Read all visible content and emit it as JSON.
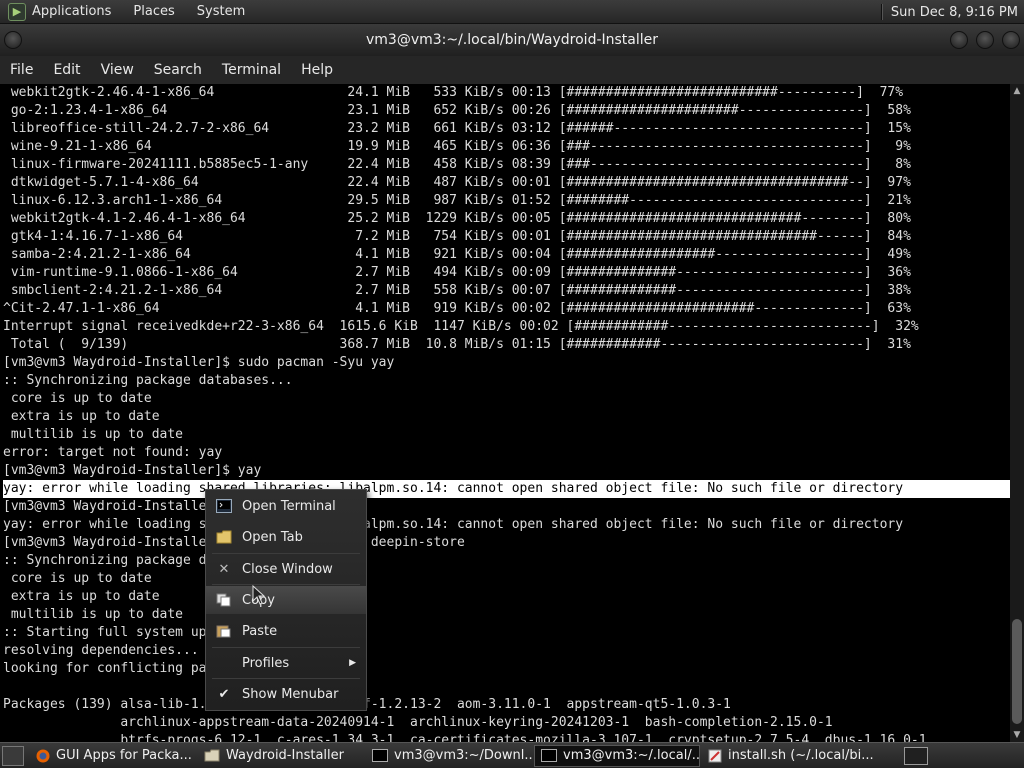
{
  "top_panel": {
    "menus": [
      "Applications",
      "Places",
      "System"
    ],
    "clock": "Sun Dec  8,  9:16 PM"
  },
  "window": {
    "title": "vm3@vm3:~/.local/bin/Waydroid-Installer"
  },
  "menubar": [
    "File",
    "Edit",
    "View",
    "Search",
    "Terminal",
    "Help"
  ],
  "terminal": {
    "lines": [
      " webkit2gtk-2.46.4-1-x86_64                 24.1 MiB   533 KiB/s 00:13 [###########################----------]  77%",
      " go-2:1.23.4-1-x86_64                       23.1 MiB   652 KiB/s 00:26 [######################----------------]  58%",
      " libreoffice-still-24.2.7-2-x86_64          23.2 MiB   661 KiB/s 03:12 [######--------------------------------]  15%",
      " wine-9.21-1-x86_64                         19.9 MiB   465 KiB/s 06:36 [###-----------------------------------]   9%",
      " linux-firmware-20241111.b5885ec5-1-any     22.4 MiB   458 KiB/s 08:39 [###-----------------------------------]   8%",
      " dtkwidget-5.7.1-4-x86_64                   22.4 MiB   487 KiB/s 00:01 [####################################--]  97%",
      " linux-6.12.3.arch1-1-x86_64                29.5 MiB   987 KiB/s 01:52 [########------------------------------]  21%",
      " webkit2gtk-4.1-2.46.4-1-x86_64             25.2 MiB  1229 KiB/s 00:05 [##############################--------]  80%",
      " gtk4-1:4.16.7-1-x86_64                      7.2 MiB   754 KiB/s 00:01 [################################------]  84%",
      " samba-2:4.21.2-1-x86_64                     4.1 MiB   921 KiB/s 00:04 [###################-------------------]  49%",
      " vim-runtime-9.1.0866-1-x86_64               2.7 MiB   494 KiB/s 00:09 [##############------------------------]  36%",
      " smbclient-2:4.21.2-1-x86_64                 2.7 MiB   558 KiB/s 00:07 [##############------------------------]  38%",
      "^Cit-2.47.1-1-x86_64                         4.1 MiB   919 KiB/s 00:02 [########################--------------]  63%",
      "Interrupt signal receivedkde+r22-3-x86_64  1615.6 KiB  1147 KiB/s 00:02 [############--------------------------]  32%",
      " Total (  9/139)                           368.7 MiB  10.8 MiB/s 01:15 [############--------------------------]  31%",
      "[vm3@vm3 Waydroid-Installer]$ sudo pacman -Syu yay",
      ":: Synchronizing package databases...",
      " core is up to date",
      " extra is up to date",
      " multilib is up to date",
      "error: target not found: yay",
      "[vm3@vm3 Waydroid-Installer]$ yay",
      "yay: error while loading shared libraries: libalpm.so.14: cannot open shared object file: No such file or directory",
      "[vm3@vm3 Waydroid-Installer]$ yay",
      "yay: error while loading shared libraries: libalpm.so.14: cannot open shared object file: No such file or directory",
      "[vm3@vm3 Waydroid-Installer]$ sudo pacman -Syu deepin-store",
      ":: Synchronizing package databases...",
      " core is up to date",
      " extra is up to date",
      " multilib is up to date",
      ":: Starting full system upgrade...",
      "resolving dependencies...",
      "looking for conflicting packages...",
      "",
      "Packages (139) alsa-lib-1.2.13-1  alsa-ucm-conf-1.2.13-2  aom-3.11.0-1  appstream-qt5-1.0.3-1",
      "               archlinux-appstream-data-20240914-1  archlinux-keyring-20241203-1  bash-completion-2.15.0-1",
      "               btrfs-progs-6.12-1  c-ares-1.34.3-1  ca-certificates-mozilla-3.107-1  cryptsetup-2.7.5-4  dbus-1.16.0-1"
    ],
    "highlighted_line": 22
  },
  "context_menu": {
    "items": [
      {
        "label": "Open Terminal",
        "icon": "terminal-icon"
      },
      {
        "label": "Open Tab",
        "icon": "folder-tab-icon"
      },
      {
        "label": "Close Window",
        "icon": "close-icon"
      },
      {
        "label": "Copy",
        "icon": "copy-icon"
      },
      {
        "label": "Paste",
        "icon": "paste-icon"
      },
      {
        "label": "Profiles",
        "icon": "submenu-arrow-icon"
      },
      {
        "label": "Show Menubar",
        "icon": "checkmark-icon"
      }
    ],
    "hovered_item": "Copy"
  },
  "taskbar": {
    "tasks": [
      {
        "label": "GUI Apps for Packa...",
        "icon": "firefox-icon"
      },
      {
        "label": "Waydroid-Installer",
        "icon": "folder-icon"
      },
      {
        "label": "vm3@vm3:~/Downl...",
        "icon": "terminal-icon"
      },
      {
        "label": "vm3@vm3:~/.local/...",
        "icon": "terminal-icon",
        "active": true
      },
      {
        "label": "install.sh (~/.local/bi...",
        "icon": "text-editor-icon"
      }
    ]
  },
  "colors": {
    "terminal_bg": "#000000",
    "terminal_fg": "#dcdcdc",
    "highlight_bg": "#ffffff",
    "panel_bg": "#2a2a2a"
  }
}
